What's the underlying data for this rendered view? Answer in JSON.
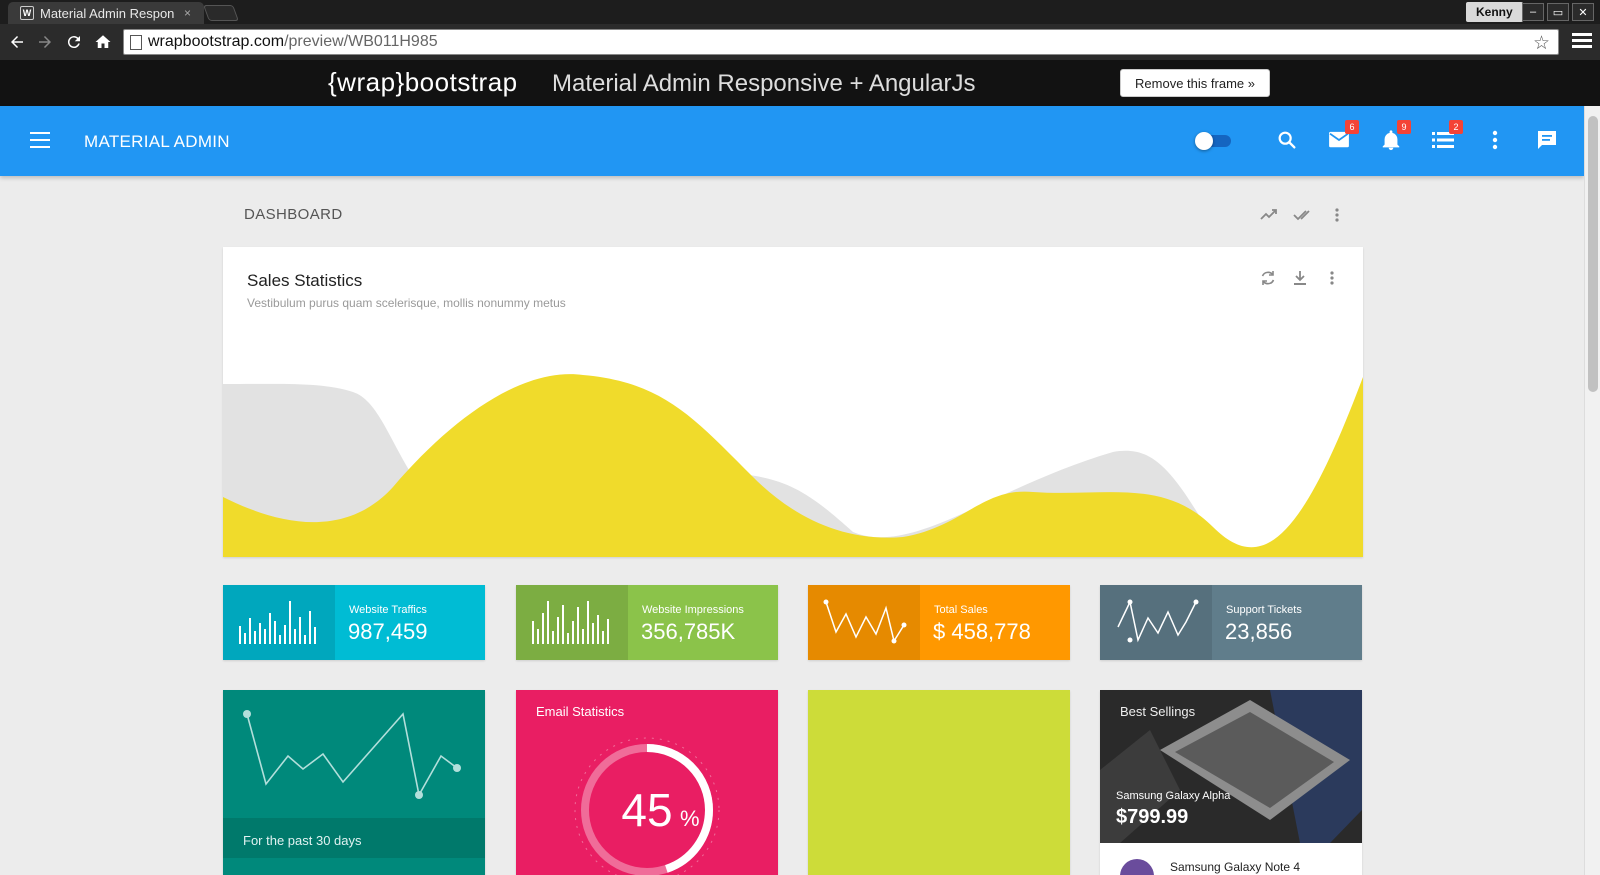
{
  "browser": {
    "tab_title": "Material Admin Respon",
    "tab_favicon": "W",
    "tab_close": "×",
    "user": "Kenny",
    "window_buttons": [
      "–",
      "▭",
      "✕"
    ],
    "url_host": "wrapbootstrap.com",
    "url_path": "/preview/WB011H985"
  },
  "frame": {
    "brand": "{wrap}bootstrap",
    "title": "Material Admin Responsive + AngularJs",
    "remove_label": "Remove this frame »"
  },
  "header": {
    "title": "MATERIAL ADMIN",
    "badges": {
      "mail": "6",
      "notifications": "9",
      "tasks": "2"
    },
    "primary_color": "#2196f3",
    "icons": [
      "menu-icon",
      "toggle",
      "search-icon",
      "mail-icon",
      "bell-icon",
      "list-icon",
      "more-vert-icon",
      "chat-icon"
    ]
  },
  "dashboard": {
    "title": "DASHBOARD"
  },
  "sales": {
    "title": "Sales Statistics",
    "subtitle": "Vestibulum purus quam scelerisque, mollis nonummy metus",
    "series_colors": {
      "primary": "#f0db2b",
      "secondary": "#e2e2e2"
    }
  },
  "minis": [
    {
      "label": "Website Traffics",
      "value": "987,459",
      "color": "#00bcd4",
      "dark": "#00a7bd"
    },
    {
      "label": "Website Impressions",
      "value": "356,785K",
      "color": "#8bc34a",
      "dark": "#7cad42"
    },
    {
      "label": "Total Sales",
      "value": "$ 458,778",
      "color": "#ff9800",
      "dark": "#e68a00"
    },
    {
      "label": "Support Tickets",
      "value": "23,856",
      "color": "#607d8b",
      "dark": "#56707d"
    }
  ],
  "cards": {
    "green_footer": "For the past 30 days",
    "email_title": "Email Statistics",
    "email_percent": "45",
    "email_percent_sign": "%",
    "best_title": "Best Sellings",
    "best_product": "Samsung Galaxy Alpha",
    "best_price": "$799.99",
    "best_next": "Samsung Galaxy Note 4"
  }
}
